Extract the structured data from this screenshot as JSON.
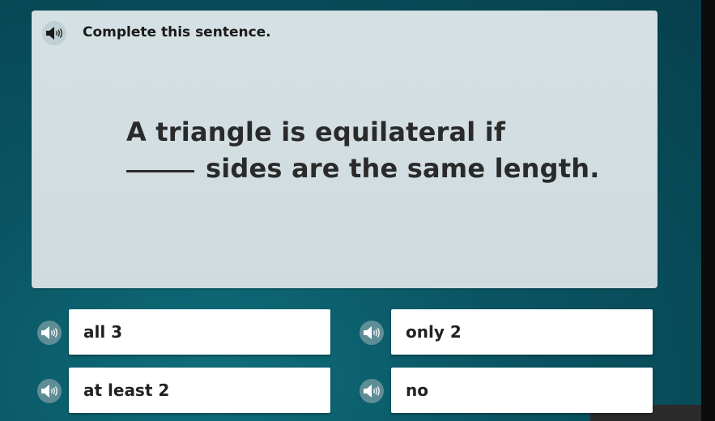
{
  "question": {
    "instruction": "Complete this sentence.",
    "speaker_icon": "speaker-icon",
    "prompt_line1": "A triangle is equilateral if",
    "prompt_line2": "sides are the same length."
  },
  "answers": [
    {
      "label": "all 3"
    },
    {
      "label": "only 2"
    },
    {
      "label": "at least 2"
    },
    {
      "label": "no"
    }
  ],
  "colors": {
    "background": "#0a5563",
    "card": "#d4e0e3",
    "tile": "#ffffff"
  }
}
